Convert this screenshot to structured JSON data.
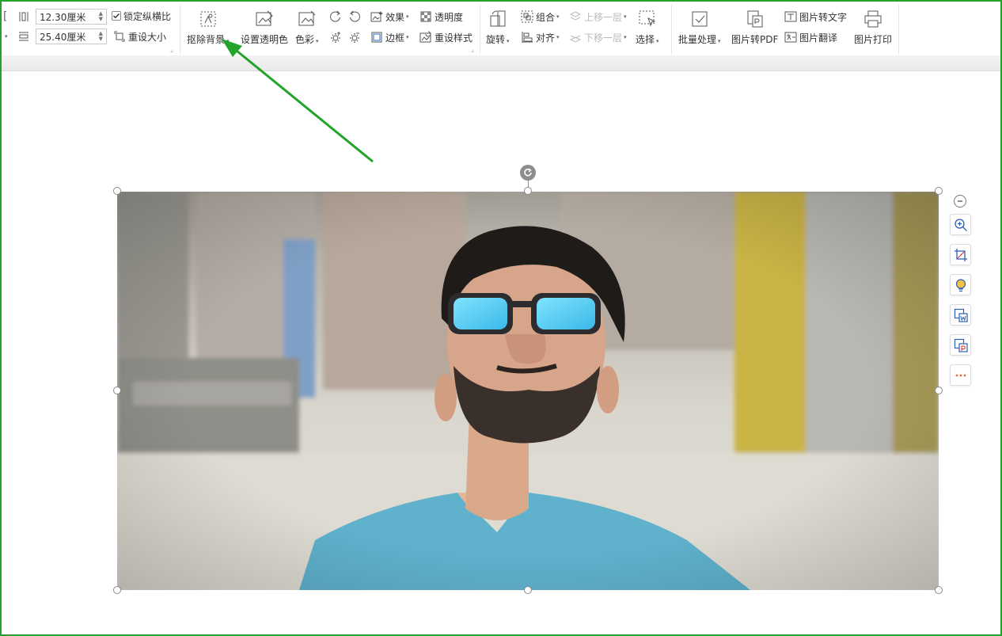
{
  "size": {
    "height_value": "12.30厘米",
    "width_value": "25.40厘米",
    "lock_ratio_label": "锁定纵横比",
    "lock_ratio_checked": true,
    "reset_size_label": "重设大小"
  },
  "image_tools": {
    "remove_bg_label": "抠除背景",
    "set_transparent_label": "设置透明色",
    "color_label": "色彩",
    "effects_label": "效果",
    "transparency_label": "透明度",
    "border_label": "边框",
    "reset_style_label": "重设样式"
  },
  "arrange": {
    "rotate_label": "旋转",
    "group_label": "组合",
    "align_label": "对齐",
    "bring_forward_label": "上移一层",
    "send_backward_label": "下移一层",
    "select_label": "选择"
  },
  "convert": {
    "batch_label": "批量处理",
    "to_pdf_label": "图片转PDF",
    "to_text_label": "图片转文字",
    "translate_label": "图片翻译",
    "print_label": "图片打印"
  },
  "accent": "#22a32a",
  "side_tools": [
    "zoom-in-icon",
    "crop-icon",
    "lightbulb-icon",
    "image-to-word-icon",
    "image-to-pdf-icon",
    "more-icon"
  ]
}
